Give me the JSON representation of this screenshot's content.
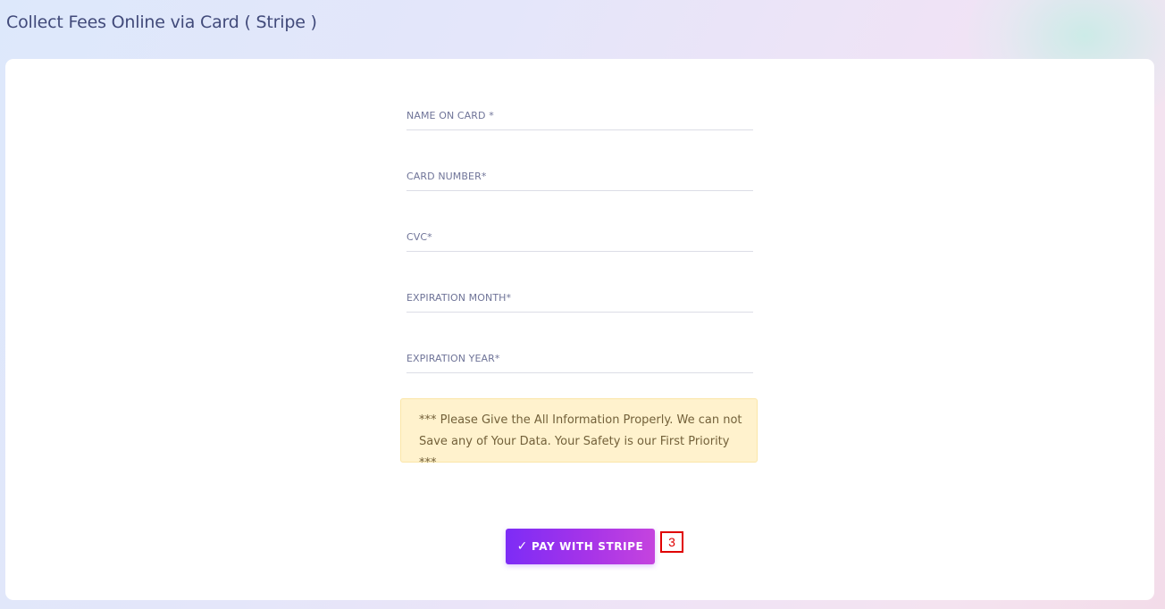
{
  "page": {
    "title": "Collect Fees Online via Card ( Stripe )"
  },
  "form": {
    "fields": [
      {
        "label": "NAME ON CARD *",
        "value": "",
        "placeholder": ""
      },
      {
        "label": "CARD NUMBER*",
        "value": "",
        "placeholder": ""
      },
      {
        "label": "CVC*",
        "value": "",
        "placeholder": ""
      },
      {
        "label": "EXPIRATION MONTH*",
        "value": "",
        "placeholder": ""
      },
      {
        "label": "EXPIRATION YEAR*",
        "value": "",
        "placeholder": ""
      }
    ],
    "notice_line1": "*** Please Give the All Information Properly. We can not",
    "notice_line2": "Save any of Your Data. Your Safety is our First Priority ***",
    "submit": {
      "icon": "check-icon",
      "icon_glyph": "✓",
      "label": "PAY WITH STRIPE"
    }
  },
  "annotation": {
    "step_number": "3",
    "color": "#e00000"
  },
  "colors": {
    "accent_start": "#7d2cf6",
    "accent_end": "#c544de",
    "notice_bg": "#fff2cd",
    "title": "#414a7a"
  }
}
